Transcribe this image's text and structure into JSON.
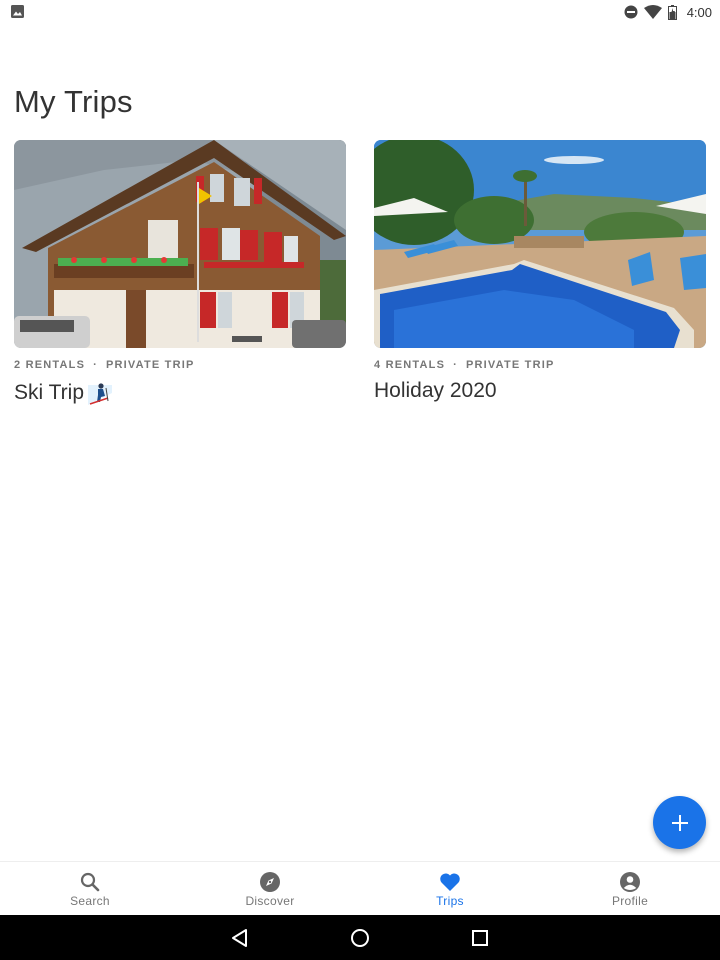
{
  "status_bar": {
    "time": "4:00",
    "left_icon": "image-icon",
    "icons": [
      "do-not-disturb-icon",
      "wifi-icon",
      "battery-icon"
    ]
  },
  "page": {
    "title": "My Trips"
  },
  "trips": [
    {
      "rentals": "2 RENTALS",
      "type": "PRIVATE TRIP",
      "title": "Ski Trip",
      "title_icon": "skier-icon",
      "image": "swiss-chalet-photo"
    },
    {
      "rentals": "4 RENTALS",
      "type": "PRIVATE TRIP",
      "title": "Holiday 2020",
      "image": "swimming-pool-photo"
    }
  ],
  "meta_separator": "·",
  "fab": {
    "icon": "plus-icon",
    "color": "#1a73e8"
  },
  "bottom_nav": {
    "active_color": "#1a73e8",
    "inactive_color": "#777777",
    "items": [
      {
        "label": "Search",
        "icon": "search-icon",
        "active": false
      },
      {
        "label": "Discover",
        "icon": "compass-icon",
        "active": false
      },
      {
        "label": "Trips",
        "icon": "heart-icon",
        "active": true
      },
      {
        "label": "Profile",
        "icon": "profile-icon",
        "active": false
      }
    ]
  },
  "system_nav": {
    "buttons": [
      "back-button",
      "home-button",
      "recents-button"
    ]
  }
}
